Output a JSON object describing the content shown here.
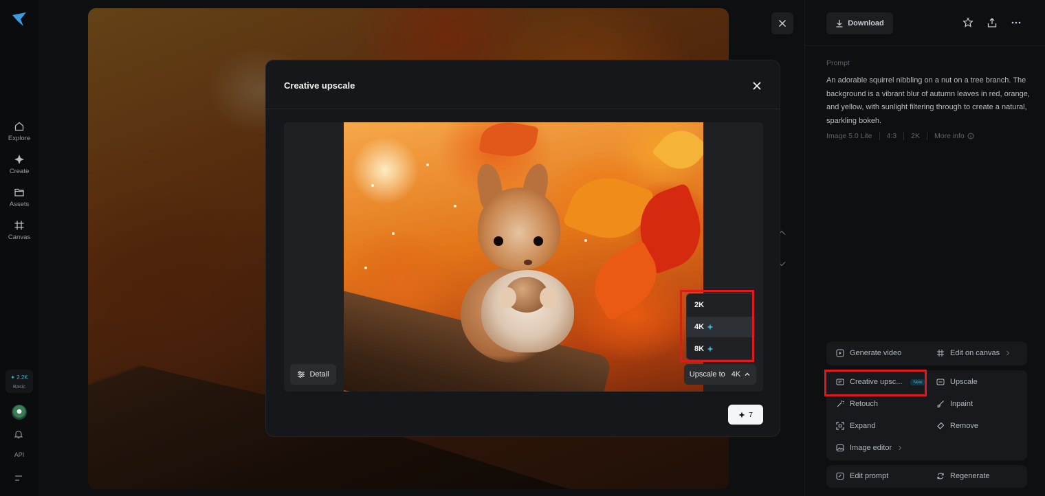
{
  "nav": {
    "items": [
      {
        "label": "Explore",
        "icon": "home-icon"
      },
      {
        "label": "Create",
        "icon": "sparkle-icon"
      },
      {
        "label": "Assets",
        "icon": "folder-icon"
      },
      {
        "label": "Canvas",
        "icon": "canvas-icon"
      }
    ],
    "credits": {
      "amount": "2.2K",
      "plan": "Basic"
    },
    "api_label": "API"
  },
  "viewer": {
    "download_label": "Download",
    "prompt_label": "Prompt",
    "prompt_text": "An adorable squirrel nibbling on a nut on a tree branch. The background is a vibrant blur of autumn leaves in red, orange, and yellow, with sunlight filtering through to create a natural, sparkling bokeh.",
    "meta": {
      "model": "Image 5.0 Lite",
      "ratio": "4:3",
      "resolution": "2K",
      "more_info": "More info"
    },
    "actions_primary": [
      {
        "label": "Generate video",
        "icon": "play-square-icon"
      },
      {
        "label": "Edit on canvas",
        "icon": "canvas-icon"
      }
    ],
    "actions_edit": [
      {
        "label": "Creative upsc...",
        "badge": "New",
        "icon": "creative-upscale-icon"
      },
      {
        "label": "Upscale",
        "icon": "upscale-icon"
      },
      {
        "label": "Retouch",
        "icon": "wand-icon"
      },
      {
        "label": "Inpaint",
        "icon": "brush-icon"
      },
      {
        "label": "Expand",
        "icon": "expand-icon"
      },
      {
        "label": "Remove",
        "icon": "eraser-icon"
      },
      {
        "label": "Image editor",
        "icon": "image-editor-icon"
      }
    ],
    "actions_bottom": [
      {
        "label": "Edit prompt",
        "icon": "edit-icon"
      },
      {
        "label": "Regenerate",
        "icon": "refresh-icon"
      }
    ]
  },
  "modal": {
    "title": "Creative upscale",
    "detail_label": "Detail",
    "upscale_prefix": "Upscale to",
    "upscale_value": "4K",
    "options": [
      {
        "label": "2K",
        "premium": false
      },
      {
        "label": "4K",
        "premium": true
      },
      {
        "label": "8K",
        "premium": true
      }
    ],
    "selected_option": "4K",
    "cost": "7"
  },
  "colors": {
    "accent": "#3fb0c8",
    "highlight": "#e0191f"
  }
}
